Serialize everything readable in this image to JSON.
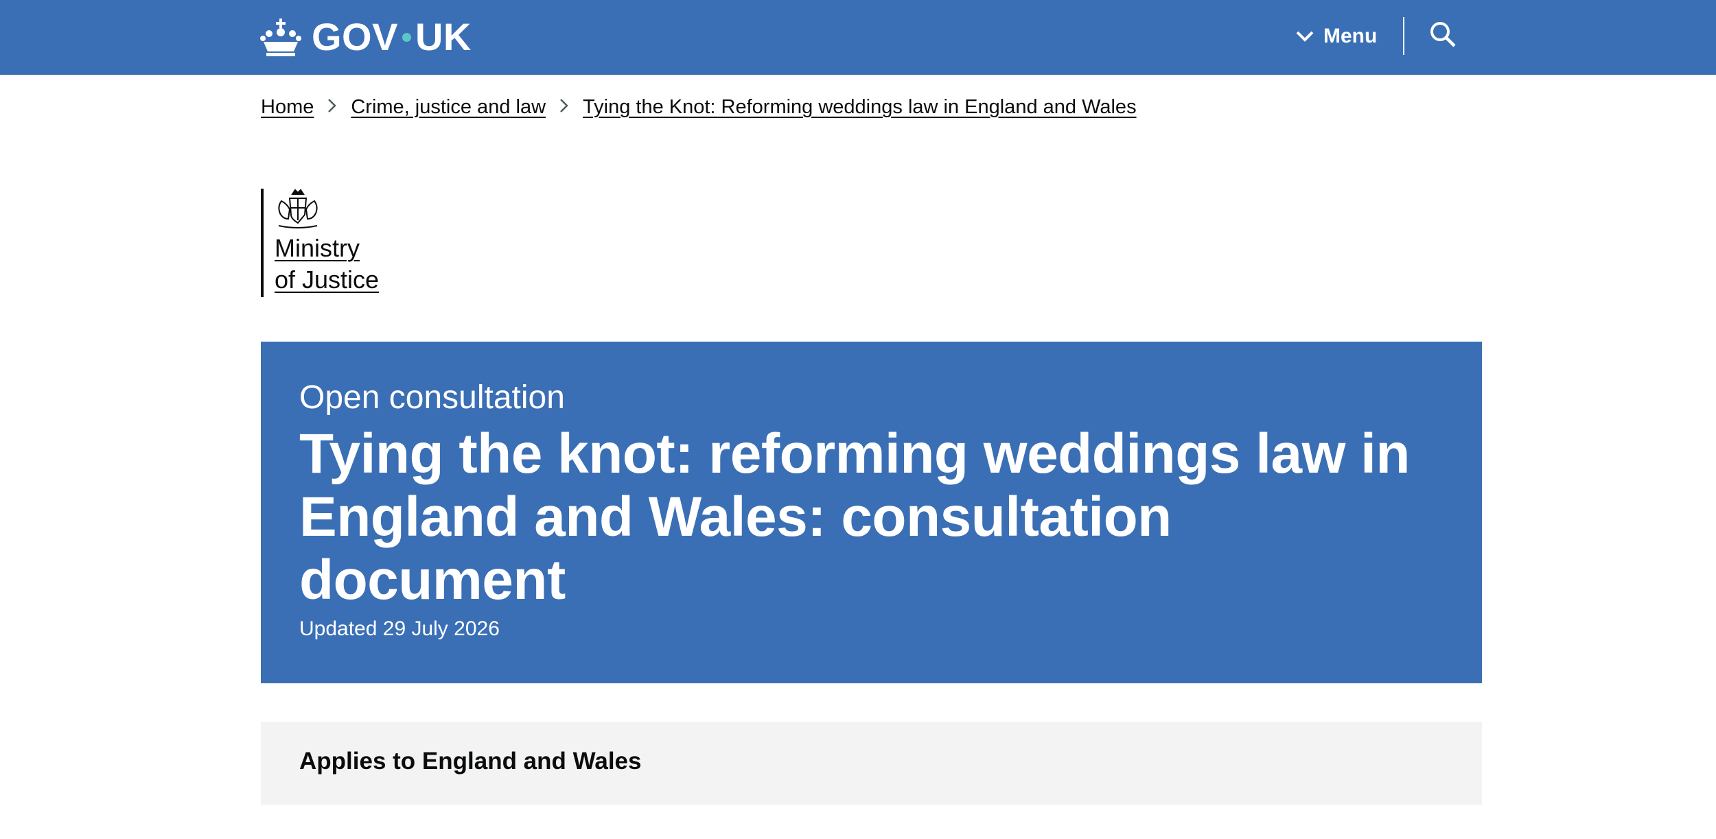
{
  "header": {
    "logo_text_left": "GOV",
    "logo_text_right": "UK",
    "menu_label": "Menu",
    "search_icon": "search-icon",
    "accent_color": "#3a6fb5",
    "logo_dot_color": "#5cc6c7"
  },
  "breadcrumb": {
    "items": [
      "Home",
      "Crime, justice and law",
      "Tying the Knot: Reforming weddings law in England and Wales"
    ]
  },
  "organisation": {
    "name_line1": "Ministry",
    "name_line2": "of Justice",
    "crest_icon": "royal-coat-of-arms-icon"
  },
  "hero": {
    "kicker": "Open consultation",
    "title": "Tying the knot: reforming weddings law in England and Wales: consultation document",
    "updated": "Updated 29 July 2026"
  },
  "applies": {
    "text": "Applies to England and Wales",
    "background_color": "#f3f3f3"
  }
}
